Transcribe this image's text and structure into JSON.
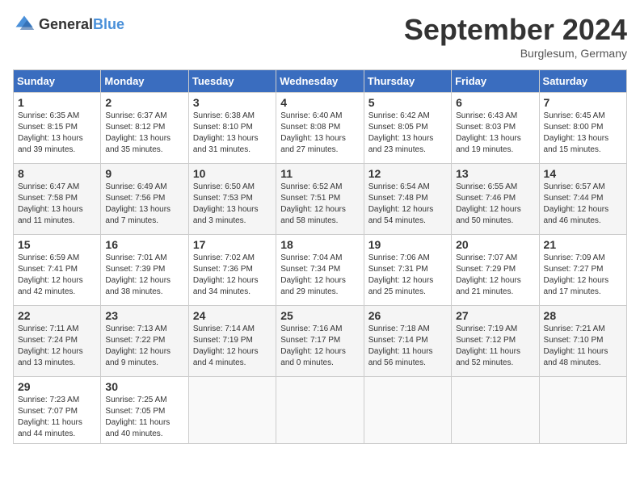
{
  "header": {
    "logo_general": "General",
    "logo_blue": "Blue",
    "month_title": "September 2024",
    "location": "Burglesum, Germany"
  },
  "days_of_week": [
    "Sunday",
    "Monday",
    "Tuesday",
    "Wednesday",
    "Thursday",
    "Friday",
    "Saturday"
  ],
  "weeks": [
    [
      {
        "day": "1",
        "sunrise": "6:35 AM",
        "sunset": "8:15 PM",
        "daylight": "13 hours and 39 minutes."
      },
      {
        "day": "2",
        "sunrise": "6:37 AM",
        "sunset": "8:12 PM",
        "daylight": "13 hours and 35 minutes."
      },
      {
        "day": "3",
        "sunrise": "6:38 AM",
        "sunset": "8:10 PM",
        "daylight": "13 hours and 31 minutes."
      },
      {
        "day": "4",
        "sunrise": "6:40 AM",
        "sunset": "8:08 PM",
        "daylight": "13 hours and 27 minutes."
      },
      {
        "day": "5",
        "sunrise": "6:42 AM",
        "sunset": "8:05 PM",
        "daylight": "13 hours and 23 minutes."
      },
      {
        "day": "6",
        "sunrise": "6:43 AM",
        "sunset": "8:03 PM",
        "daylight": "13 hours and 19 minutes."
      },
      {
        "day": "7",
        "sunrise": "6:45 AM",
        "sunset": "8:00 PM",
        "daylight": "13 hours and 15 minutes."
      }
    ],
    [
      {
        "day": "8",
        "sunrise": "6:47 AM",
        "sunset": "7:58 PM",
        "daylight": "13 hours and 11 minutes."
      },
      {
        "day": "9",
        "sunrise": "6:49 AM",
        "sunset": "7:56 PM",
        "daylight": "13 hours and 7 minutes."
      },
      {
        "day": "10",
        "sunrise": "6:50 AM",
        "sunset": "7:53 PM",
        "daylight": "13 hours and 3 minutes."
      },
      {
        "day": "11",
        "sunrise": "6:52 AM",
        "sunset": "7:51 PM",
        "daylight": "12 hours and 58 minutes."
      },
      {
        "day": "12",
        "sunrise": "6:54 AM",
        "sunset": "7:48 PM",
        "daylight": "12 hours and 54 minutes."
      },
      {
        "day": "13",
        "sunrise": "6:55 AM",
        "sunset": "7:46 PM",
        "daylight": "12 hours and 50 minutes."
      },
      {
        "day": "14",
        "sunrise": "6:57 AM",
        "sunset": "7:44 PM",
        "daylight": "12 hours and 46 minutes."
      }
    ],
    [
      {
        "day": "15",
        "sunrise": "6:59 AM",
        "sunset": "7:41 PM",
        "daylight": "12 hours and 42 minutes."
      },
      {
        "day": "16",
        "sunrise": "7:01 AM",
        "sunset": "7:39 PM",
        "daylight": "12 hours and 38 minutes."
      },
      {
        "day": "17",
        "sunrise": "7:02 AM",
        "sunset": "7:36 PM",
        "daylight": "12 hours and 34 minutes."
      },
      {
        "day": "18",
        "sunrise": "7:04 AM",
        "sunset": "7:34 PM",
        "daylight": "12 hours and 29 minutes."
      },
      {
        "day": "19",
        "sunrise": "7:06 AM",
        "sunset": "7:31 PM",
        "daylight": "12 hours and 25 minutes."
      },
      {
        "day": "20",
        "sunrise": "7:07 AM",
        "sunset": "7:29 PM",
        "daylight": "12 hours and 21 minutes."
      },
      {
        "day": "21",
        "sunrise": "7:09 AM",
        "sunset": "7:27 PM",
        "daylight": "12 hours and 17 minutes."
      }
    ],
    [
      {
        "day": "22",
        "sunrise": "7:11 AM",
        "sunset": "7:24 PM",
        "daylight": "12 hours and 13 minutes."
      },
      {
        "day": "23",
        "sunrise": "7:13 AM",
        "sunset": "7:22 PM",
        "daylight": "12 hours and 9 minutes."
      },
      {
        "day": "24",
        "sunrise": "7:14 AM",
        "sunset": "7:19 PM",
        "daylight": "12 hours and 4 minutes."
      },
      {
        "day": "25",
        "sunrise": "7:16 AM",
        "sunset": "7:17 PM",
        "daylight": "12 hours and 0 minutes."
      },
      {
        "day": "26",
        "sunrise": "7:18 AM",
        "sunset": "7:14 PM",
        "daylight": "11 hours and 56 minutes."
      },
      {
        "day": "27",
        "sunrise": "7:19 AM",
        "sunset": "7:12 PM",
        "daylight": "11 hours and 52 minutes."
      },
      {
        "day": "28",
        "sunrise": "7:21 AM",
        "sunset": "7:10 PM",
        "daylight": "11 hours and 48 minutes."
      }
    ],
    [
      {
        "day": "29",
        "sunrise": "7:23 AM",
        "sunset": "7:07 PM",
        "daylight": "11 hours and 44 minutes."
      },
      {
        "day": "30",
        "sunrise": "7:25 AM",
        "sunset": "7:05 PM",
        "daylight": "11 hours and 40 minutes."
      },
      null,
      null,
      null,
      null,
      null
    ]
  ]
}
